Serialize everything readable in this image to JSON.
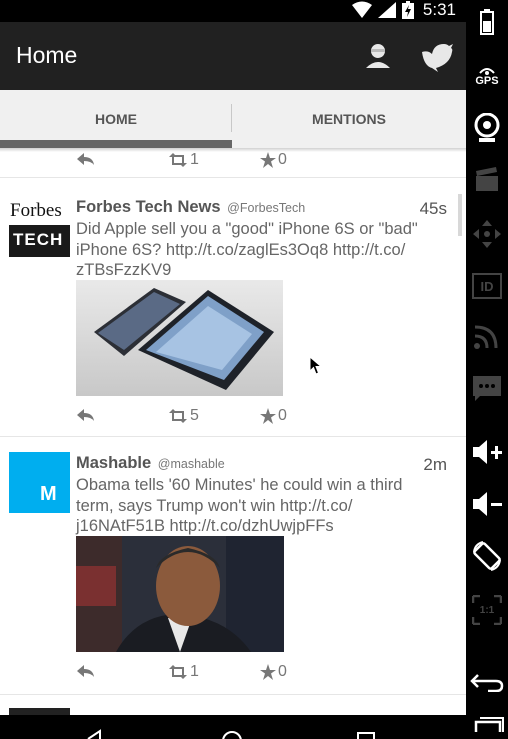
{
  "status_bar": {
    "time": "5:31"
  },
  "app_bar": {
    "title": "Home"
  },
  "tabs": [
    {
      "label": "HOME",
      "selected": true
    },
    {
      "label": "MENTIONS",
      "selected": false
    }
  ],
  "feed": {
    "top_partial_actions": {
      "retweets": "1",
      "favorites": "0"
    },
    "tweets": [
      {
        "avatar_text_line1": "Forbes",
        "avatar_text_line2": "TECH",
        "name": "Forbes Tech News",
        "handle": "@ForbesTech",
        "time": "45s",
        "text_lines": [
          "Did Apple sell you a \"good\" iPhone 6S or \"bad\"",
          "iPhone 6S? http://t.co/zaglEs3Oq8 http://t.co/",
          "zTBsFzzKV9"
        ],
        "retweets": "5",
        "favorites": "0"
      },
      {
        "avatar_text": "M",
        "avatar_color": "#00aeef",
        "name": "Mashable",
        "handle": "@mashable",
        "time": "2m",
        "text_lines": [
          "Obama tells '60 Minutes' he could win a third",
          "term, says Trump won't win http://t.co/",
          "j16NAtF51B http://t.co/dzhUwjpFFs"
        ],
        "retweets": "1",
        "favorites": "0"
      }
    ]
  },
  "side_panel": {
    "gps_label": "GPS",
    "id_label": "ID",
    "scale_label": "1:1"
  },
  "colors": {
    "app_bar": "#212121",
    "tab_bg": "#f0f0f0",
    "tab_indicator": "#666666",
    "mashable_blue": "#00aeef"
  }
}
